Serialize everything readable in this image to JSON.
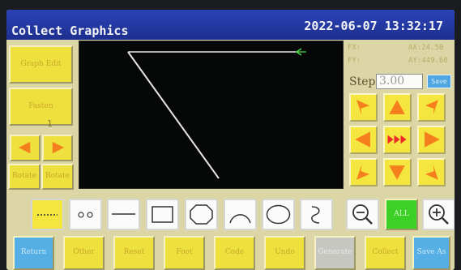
{
  "window": {
    "title": "Collect Graphics",
    "datetime": "2022-06-07  13:32:17"
  },
  "left_panel": {
    "graph_edit": "Graph Edit",
    "fasten": "Fasten",
    "counter": "1",
    "rotate_left": "Rotate",
    "rotate_right": "Rotate"
  },
  "readouts": {
    "fx": "FX:",
    "fy": "FY:",
    "ax": "AX:24.50",
    "ay": "AY:449.60"
  },
  "step": {
    "label": "Step",
    "value": "3.00",
    "save_label": "Save"
  },
  "zoom": {
    "all_label": "ALL"
  },
  "bottom_bar": {
    "return": "Return",
    "other": "Other",
    "reset": "Reset",
    "foot": "Foot",
    "code": "Code",
    "undo": "Undo",
    "generate": "Generate",
    "collect": "Collect",
    "save_as": "Save As"
  },
  "icons": {
    "direction_pad": [
      "arrow-up-left",
      "arrow-up",
      "arrow-up-right",
      "arrow-left",
      "fast-forward",
      "arrow-right",
      "arrow-down-left",
      "arrow-down",
      "arrow-down-right"
    ],
    "tools": [
      "dotted-line",
      "two-points",
      "line",
      "rectangle",
      "octagon",
      "arc",
      "ellipse",
      "curve",
      "zoom-out",
      "zoom-in"
    ]
  },
  "colors": {
    "title_bar": "#233aa6",
    "panel": "#dcd6a6",
    "button": "#eee13e",
    "arrow": "#f47f1c",
    "accent_blue": "#55aee4",
    "accent_green": "#3dd127",
    "canvas": "#060707",
    "trace": "#e6e6e6"
  }
}
